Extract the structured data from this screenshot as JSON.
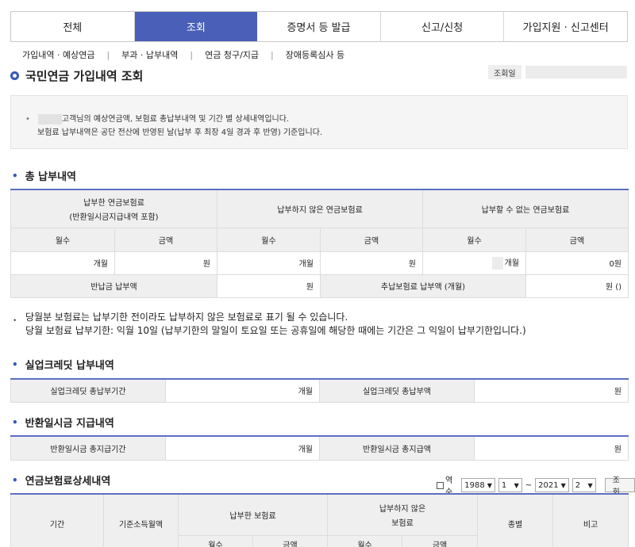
{
  "tabs": [
    "전체",
    "조회",
    "증명서 등 발급",
    "신고/신청",
    "가입지원 · 신고센터"
  ],
  "subnav": [
    "가입내역 · 예상연금",
    "부과 · 납부내역",
    "연금 청구/지급",
    "장애등록심사 등"
  ],
  "page_title": "국민연금 가입내역 조회",
  "lookup_date_label": "조회일",
  "notice": {
    "line1": "고객님의 예상연금액, 보험료 총납부내역 및 기간 별 상세내역입니다.",
    "line2": "보험료 납부내역은 공단 전산에 반영된 날(납부 후 최장 4일 경과 후 반영) 기준입니다."
  },
  "total": {
    "title": "총 납부내역",
    "h_paid": "납부한 연금보험료",
    "h_paid_sub": "(반환일시금지급내역 포함)",
    "h_unpaid": "납부하지 않은 연금보험료",
    "h_cannot": "납부할 수 없는 연금보험료",
    "months": "월수",
    "amount": "금액",
    "month_unit": "개월",
    "won_unit": "원",
    "cannot_amount": "0원",
    "refund_label": "반납금 납부액",
    "extra_label": "추납보험료 납부액 (개월)",
    "extra_value": "원 ()"
  },
  "remarks": [
    "당월분 보험료는 납부기한 전이라도 납부하지 않은 보험료로 표기 될 수 있습니다.",
    "당월 보험료 납부기한: 익월 10일 (납부기한의 말일이 토요일 또는 공휴일에 해당한 때에는 기간은 그 익일이 납부기한입니다.)"
  ],
  "unemployment": {
    "title": "실업크레딧 납부내역",
    "period_label": "실업크레딧 총납부기간",
    "period_value": "개월",
    "amount_label": "실업크레딧 총납부액",
    "amount_value": "원"
  },
  "refund": {
    "title": "반환일시금 지급내역",
    "period_label": "반환일시금 총지급기간",
    "period_value": "개월",
    "amount_label": "반환일시금 총지급액",
    "amount_value": "원"
  },
  "detail": {
    "title": "연금보험료상세내역",
    "reverse_label": "역순",
    "from_year": "1988",
    "from_month": "1",
    "tilde": "~",
    "to_year": "2021",
    "to_month": "2",
    "lookup_button": "조회",
    "h_period": "기간",
    "h_base_income": "기준소득월액",
    "h_paid": "납부한 보험료",
    "h_unpaid_1": "납부하지 않은",
    "h_unpaid_2": "보험료",
    "h_type": "종별",
    "h_note": "비고",
    "months": "월수",
    "amount": "금액"
  }
}
